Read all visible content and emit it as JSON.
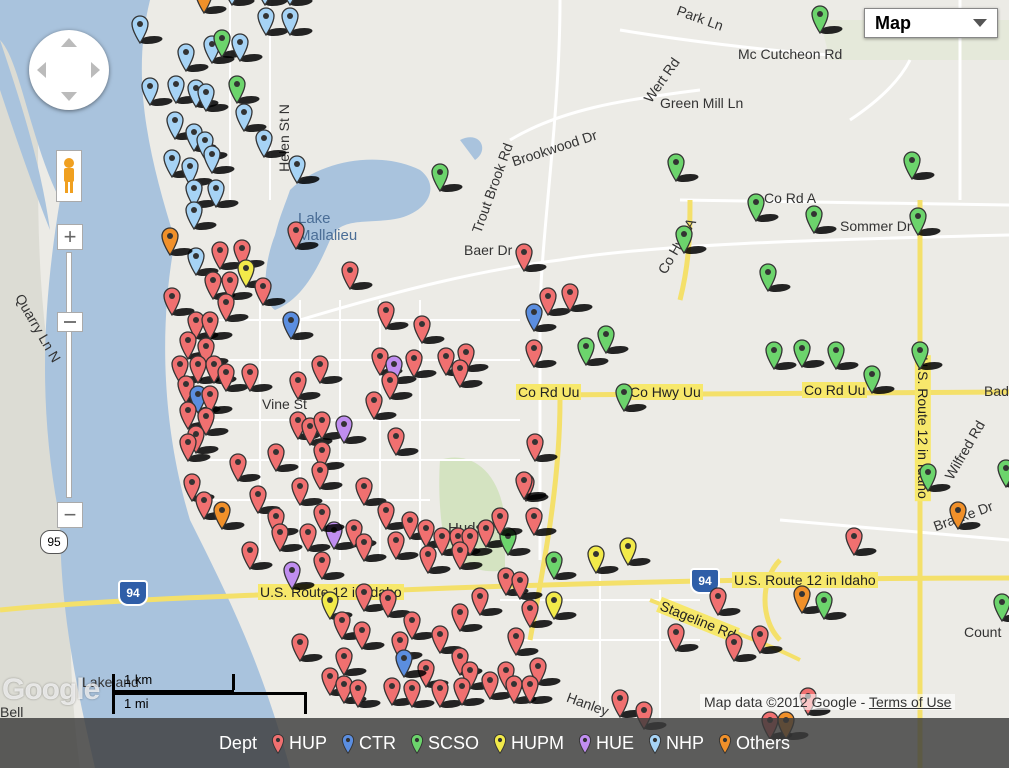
{
  "map": {
    "map_type_label": "Map",
    "attribution": "Map data ©2012 Google - ",
    "terms_link": "Terms of Use",
    "logo_text": "Google",
    "scale_metric": "1 km",
    "scale_imperial": "1 mi"
  },
  "labels": {
    "lake": "Lake Mallalieu",
    "hudson": "Hudson",
    "park_ln": "Park Ln",
    "mccutcheon": "Mc Cutcheon Rd",
    "wert": "Wert Rd",
    "green_mill": "Green Mill Ln",
    "brookwood": "Brookwood Dr",
    "trout_brook": "Trout Brook Rd",
    "baer": "Baer Dr",
    "co_rd_a": "Co Rd A",
    "sommer": "Sommer Dr",
    "co_hwy_a": "Co Hwy A",
    "co_rd_uu_west": "Co Rd Uu",
    "co_hwy_uu": "Co Hwy Uu",
    "co_rd_uu_east": "Co Rd Uu",
    "vine": "Vine St",
    "helen": "Helen St N",
    "quarry": "Quarry Ln N",
    "route12_west": "U.S. Route 12 in Idaho",
    "route12_east": "U.S. Route 12 in Idaho",
    "route12_vertical": "U.S. Route 12 in Idaho",
    "stageline": "Stageline Rd",
    "wilfred": "Wilfred Rd",
    "brakke": "Brakke Dr",
    "lakeland": "Lakeland",
    "bell": "Bell",
    "hanley": "Hanley",
    "count": "Count",
    "bad": "Bad",
    "i94_west": "94",
    "i94_east": "94",
    "rt95": "95"
  },
  "legend": {
    "title": "Dept",
    "items": [
      {
        "label": "HUP",
        "color": "#f07070"
      },
      {
        "label": "CTR",
        "color": "#5b8ee0"
      },
      {
        "label": "SCSO",
        "color": "#6cd46c"
      },
      {
        "label": "HUPM",
        "color": "#f2ea4a"
      },
      {
        "label": "HUE",
        "color": "#c08ef0"
      },
      {
        "label": "NHP",
        "color": "#a6d3f5"
      },
      {
        "label": "Others",
        "color": "#f0902a"
      }
    ]
  },
  "colors": {
    "water": "#a9c3dd",
    "land": "#ecebe6",
    "park": "#d4e3c1",
    "highway": "#f4e06a"
  }
}
